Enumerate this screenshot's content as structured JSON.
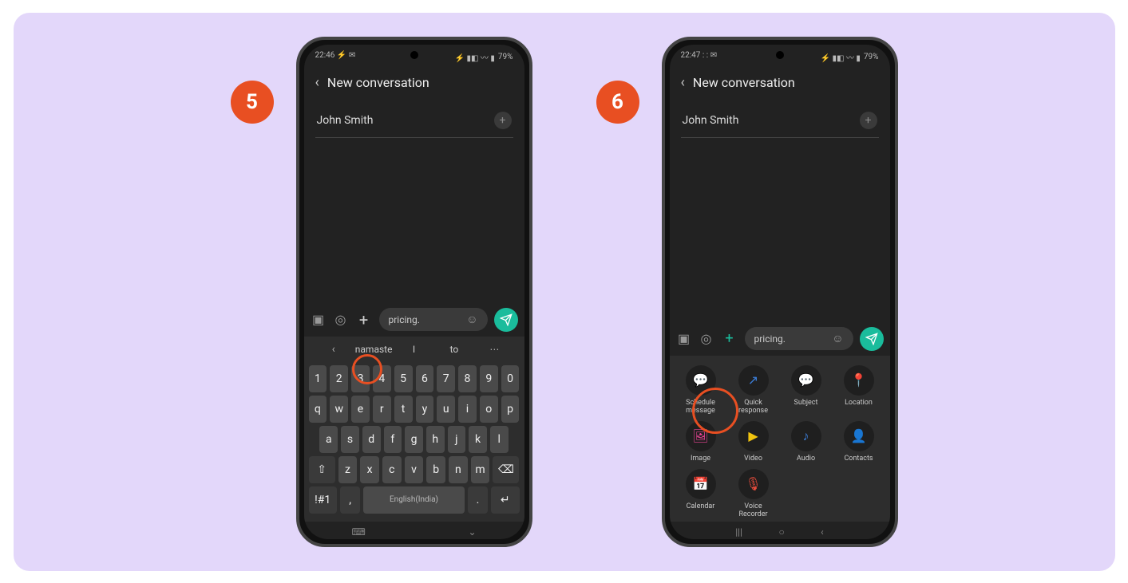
{
  "steps": {
    "s5": "5",
    "s6": "6"
  },
  "status": {
    "time5": "22:46 ⚡ ✉",
    "time6": "22:47 : : ✉",
    "battery": "79%",
    "right": "⚡ ▮◧ 〰 ▮"
  },
  "app": {
    "title": "New conversation",
    "recipient": "John Smith"
  },
  "input": {
    "text": "pricing."
  },
  "keyboard": {
    "s1": "namaste",
    "s2": "I",
    "s3": "to",
    "row1": [
      "1",
      "2",
      "3",
      "4",
      "5",
      "6",
      "7",
      "8",
      "9",
      "0"
    ],
    "row2": [
      "q",
      "w",
      "e",
      "r",
      "t",
      "y",
      "u",
      "i",
      "o",
      "p"
    ],
    "row3": [
      "a",
      "s",
      "d",
      "f",
      "g",
      "h",
      "j",
      "k",
      "l"
    ],
    "row4_mid": [
      "z",
      "x",
      "c",
      "v",
      "b",
      "n",
      "m"
    ],
    "lang": "English(India)",
    "sym": "!#1"
  },
  "attach": {
    "items": [
      {
        "label": "Schedule message",
        "color": "#3b7dd8",
        "glyph": "💬"
      },
      {
        "label": "Quick response",
        "color": "#3b7dd8",
        "glyph": "↗"
      },
      {
        "label": "Subject",
        "color": "#3b7dd8",
        "glyph": "💬"
      },
      {
        "label": "Location",
        "color": "#1abc9c",
        "glyph": "📍"
      },
      {
        "label": "Image",
        "color": "#e84393",
        "glyph": "🖼"
      },
      {
        "label": "Video",
        "color": "#f1c40f",
        "glyph": "▶"
      },
      {
        "label": "Audio",
        "color": "#3b7dd8",
        "glyph": "♪"
      },
      {
        "label": "Contacts",
        "color": "#e67e22",
        "glyph": "👤"
      },
      {
        "label": "Calendar",
        "color": "#1abc9c",
        "glyph": "📅"
      },
      {
        "label": "Voice Recorder",
        "color": "#e74c3c",
        "glyph": "🎙"
      }
    ]
  }
}
